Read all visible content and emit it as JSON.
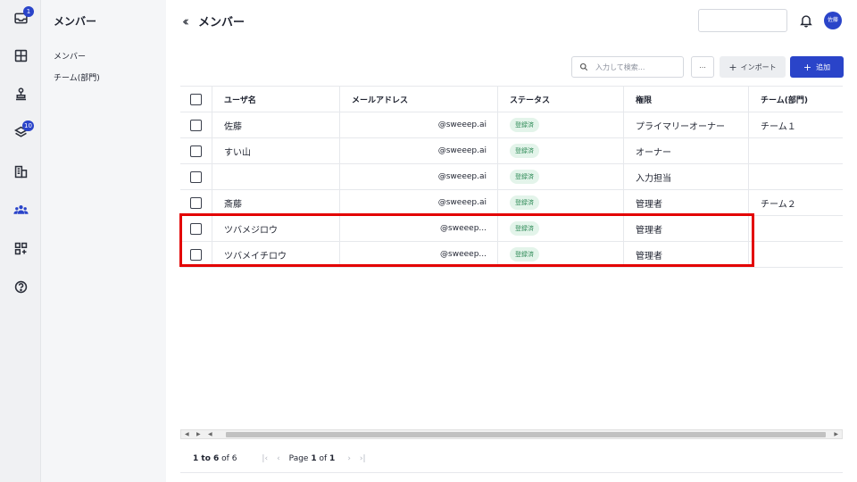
{
  "rail": {
    "items": [
      {
        "icon": "inbox-icon",
        "badge": "1"
      },
      {
        "icon": "layout-icon"
      },
      {
        "icon": "stamp-icon"
      },
      {
        "icon": "layers-icon",
        "badge": "10"
      },
      {
        "icon": "building-icon"
      },
      {
        "icon": "members-icon",
        "active": true
      },
      {
        "icon": "apps-add-icon"
      },
      {
        "icon": "help-icon"
      }
    ]
  },
  "subnav": {
    "title": "メンバー",
    "items": [
      "メンバー",
      "チーム(部門)"
    ]
  },
  "header": {
    "title": "メンバー",
    "avatar_text": "佐藤"
  },
  "toolbar": {
    "search_placeholder": "入力して検索...",
    "more_label": "...",
    "import_label": "インポート",
    "add_label": "追加"
  },
  "table": {
    "columns": [
      "ユーザ名",
      "メールアドレス",
      "ステータス",
      "権限",
      "チーム(部門)"
    ],
    "rows": [
      {
        "name": "佐藤",
        "email": "@sweeep.ai",
        "status": "登録済",
        "role": "プライマリーオーナー",
        "team": "チーム１"
      },
      {
        "name": "すい山",
        "email": "@sweeep.ai",
        "status": "登録済",
        "role": "オーナー",
        "team": ""
      },
      {
        "name": "",
        "email": "@sweeep.ai",
        "status": "登録済",
        "role": "入力担当",
        "team": ""
      },
      {
        "name": "斎藤",
        "email": "@sweeep.ai",
        "status": "登録済",
        "role": "管理者",
        "team": "チーム２"
      },
      {
        "name": "ツバメジロウ",
        "email": "@sweeep...",
        "status": "登録済",
        "role": "管理者",
        "team": ""
      },
      {
        "name": "ツバメイチロウ",
        "email": "@sweeep...",
        "status": "登録済",
        "role": "管理者",
        "team": ""
      }
    ]
  },
  "pagination": {
    "range_prefix": "1 to 6",
    "range_suffix": "of 6",
    "page_prefix": "Page",
    "page_current": "1",
    "page_of": "of",
    "page_total": "1"
  },
  "colors": {
    "accent": "#2a44c9",
    "highlight": "#e30000",
    "status_bg": "#e3f4ea",
    "status_text": "#2e8a57"
  }
}
